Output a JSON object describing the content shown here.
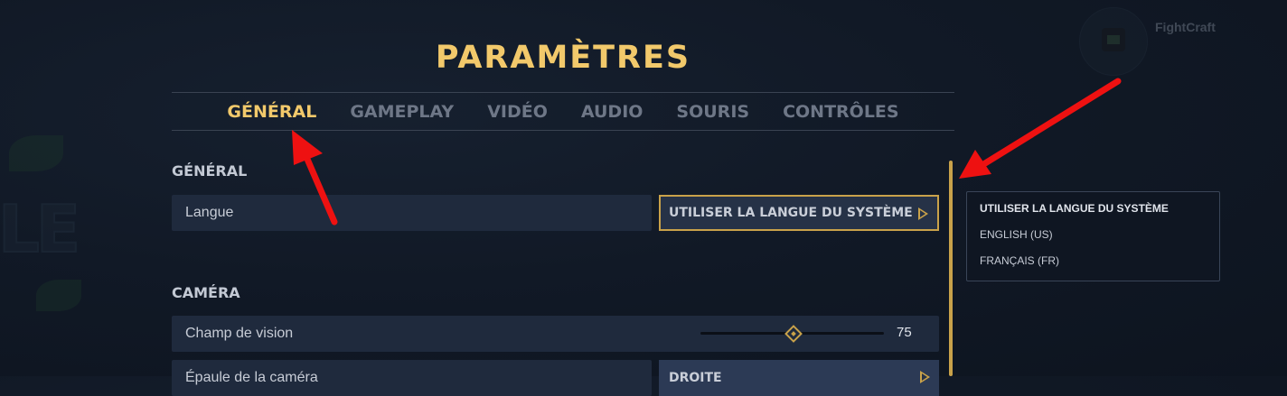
{
  "title": "PARAMÈTRES",
  "tabs": [
    {
      "label": "GÉNÉRAL",
      "active": true
    },
    {
      "label": "GAMEPLAY",
      "active": false
    },
    {
      "label": "VIDÉO",
      "active": false
    },
    {
      "label": "AUDIO",
      "active": false
    },
    {
      "label": "SOURIS",
      "active": false
    },
    {
      "label": "CONTRÔLES",
      "active": false
    }
  ],
  "profile": {
    "name": "FightCraft"
  },
  "background_logo": {
    "letters": "LE"
  },
  "sections": {
    "general": {
      "title": "GÉNÉRAL",
      "language": {
        "label": "Langue",
        "value": "UTILISER LA LANGUE DU SYSTÈME"
      }
    },
    "camera": {
      "title": "CAMÉRA",
      "fov": {
        "label": "Champ de vision",
        "value": "75",
        "slider_fraction": 0.5
      },
      "camera_side": {
        "label": "Épaule de la caméra",
        "value": "DROITE"
      }
    }
  },
  "language_dropdown": {
    "options": [
      "UTILISER LA LANGUE DU SYSTÈME",
      "ENGLISH (US)",
      "FRANÇAIS (FR)"
    ],
    "selected_index": 0
  },
  "colors": {
    "accent_gold": "#f2c96b",
    "annotation_red": "#ee1111",
    "row_bg": "#1f2a3d",
    "page_bg": "#111926"
  },
  "icons": {
    "select_arrow": "play-triangle-icon",
    "slider_thumb": "diamond-icon"
  }
}
